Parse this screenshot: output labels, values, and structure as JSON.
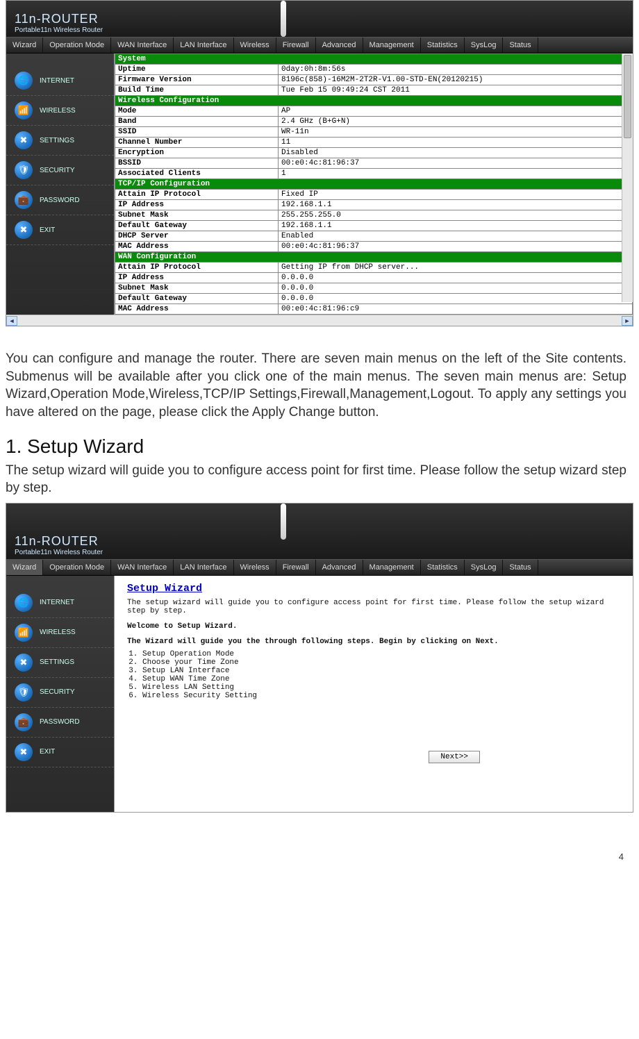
{
  "page_number": "4",
  "brand": {
    "line1": "11n-ROUTER",
    "line2": "Portable11n Wireless Router"
  },
  "nav": [
    "Wizard",
    "Operation Mode",
    "WAN Interface",
    "LAN Interface",
    "Wireless",
    "Firewall",
    "Advanced",
    "Management",
    "Statistics",
    "SysLog",
    "Status"
  ],
  "sidebar": [
    {
      "label": "INTERNET",
      "icon": "🌐"
    },
    {
      "label": "WIRELESS",
      "icon": "📶"
    },
    {
      "label": "SETTINGS",
      "icon": "✖"
    },
    {
      "label": "SECURITY",
      "icon": "🛡"
    },
    {
      "label": "PASSWORD",
      "icon": "💼"
    },
    {
      "label": "EXIT",
      "icon": "✖"
    }
  ],
  "status_sections": [
    {
      "header": "System",
      "rows": [
        {
          "k": "Uptime",
          "v": "0day:0h:8m:56s"
        },
        {
          "k": "Firmware Version",
          "v": "8196c(858)-16M2M-2T2R-V1.00-STD-EN(20120215)"
        },
        {
          "k": "Build Time",
          "v": "Tue Feb 15 09:49:24 CST 2011"
        }
      ]
    },
    {
      "header": "Wireless Configuration",
      "rows": [
        {
          "k": "Mode",
          "v": "AP"
        },
        {
          "k": "Band",
          "v": "2.4 GHz (B+G+N)"
        },
        {
          "k": "SSID",
          "v": "WR-11n"
        },
        {
          "k": "Channel Number",
          "v": "11"
        },
        {
          "k": "Encryption",
          "v": "Disabled"
        },
        {
          "k": "BSSID",
          "v": "00:e0:4c:81:96:37"
        },
        {
          "k": "Associated Clients",
          "v": "1"
        }
      ]
    },
    {
      "header": "TCP/IP Configuration",
      "rows": [
        {
          "k": "Attain IP Protocol",
          "v": "Fixed IP"
        },
        {
          "k": "IP Address",
          "v": "192.168.1.1"
        },
        {
          "k": "Subnet Mask",
          "v": "255.255.255.0"
        },
        {
          "k": "Default Gateway",
          "v": "192.168.1.1"
        },
        {
          "k": "DHCP Server",
          "v": "Enabled"
        },
        {
          "k": "MAC Address",
          "v": "00:e0:4c:81:96:37"
        }
      ]
    },
    {
      "header": "WAN Configuration",
      "rows": [
        {
          "k": "Attain IP Protocol",
          "v": "Getting IP from DHCP server..."
        },
        {
          "k": "IP Address",
          "v": "0.0.0.0"
        },
        {
          "k": "Subnet Mask",
          "v": "0.0.0.0"
        },
        {
          "k": "Default Gateway",
          "v": "0.0.0.0"
        },
        {
          "k": "MAC Address",
          "v": "00:e0:4c:81:96:c9"
        }
      ]
    }
  ],
  "doc": {
    "para1": "You can configure and manage the router. There are seven main menus on the left of the Site contents. Submenus will be available after you click one of the main menus. The seven main menus are: Setup Wizard,Operation Mode,Wireless,TCP/IP Settings,Firewall,Management,Logout. To apply any settings you have altered on the page, please click the Apply Change button.",
    "h1": "1. Setup Wizard",
    "para2": "The setup wizard will guide you to configure access point for first time. Please follow the setup wizard step by step."
  },
  "wizard": {
    "title": "Setup Wizard",
    "intro": "The setup wizard will guide you to configure access point for first time. Please follow the setup wizard step by step.",
    "welcome": "Welcome to Setup Wizard.",
    "guide": "The Wizard will guide you the through following steps. Begin by clicking on Next.",
    "steps": [
      "Setup Operation Mode",
      "Choose your Time Zone",
      "Setup LAN Interface",
      "Setup WAN Time Zone",
      "Wireless LAN Setting",
      "Wireless Security Setting"
    ],
    "next": "Next>>"
  }
}
